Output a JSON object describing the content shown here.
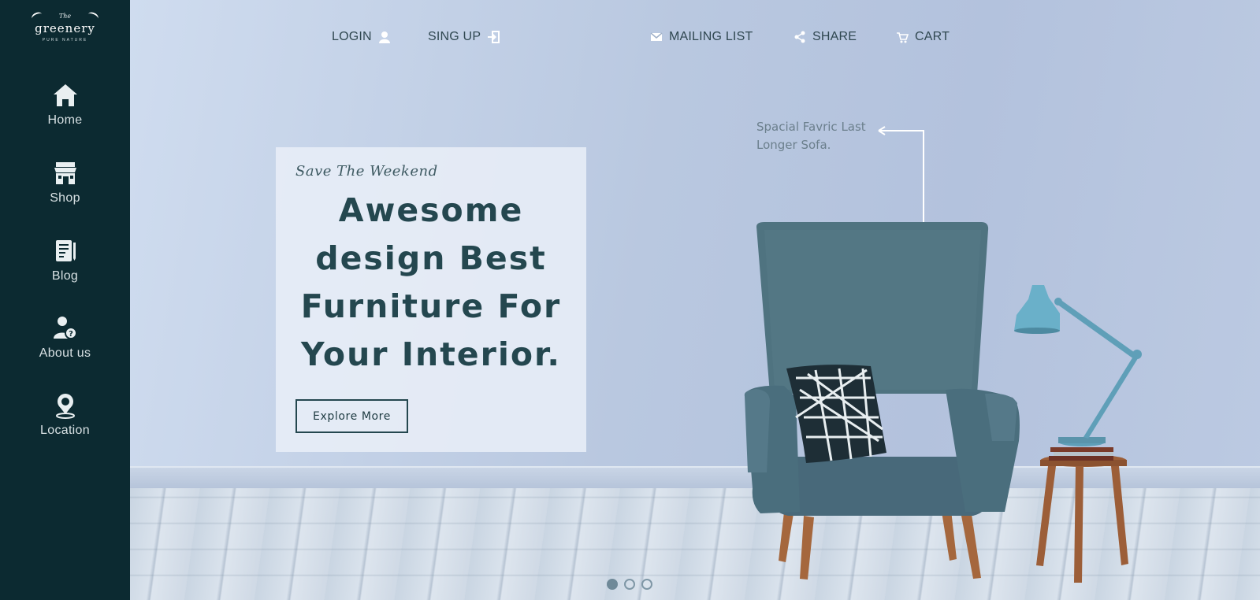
{
  "brand": {
    "the": "The",
    "name": "greenery",
    "tagline": "PURE NATURE"
  },
  "sidebar": {
    "items": [
      {
        "label": "Home",
        "icon": "home-icon"
      },
      {
        "label": "Shop",
        "icon": "shop-icon"
      },
      {
        "label": "Blog",
        "icon": "blog-icon"
      },
      {
        "label": "About us",
        "icon": "about-icon"
      },
      {
        "label": "Location",
        "icon": "location-icon"
      }
    ]
  },
  "topnav": {
    "login": "LOGIN",
    "signup": "SING UP",
    "mailing": "MAILING LIST",
    "share": "SHARE",
    "cart": "CART"
  },
  "hero": {
    "kicker": "Save The Weekend",
    "headline": "Awesome design Best Furniture For Your Interior.",
    "cta": "Explore More",
    "annotation": "Spacial Favric Last Longer Sofa.",
    "slides": 3,
    "active_slide": 1
  },
  "colors": {
    "sidebar_bg": "#0c2a31",
    "heading": "#24474f",
    "chair": "#4f7380",
    "lamp": "#5f9fb8"
  }
}
